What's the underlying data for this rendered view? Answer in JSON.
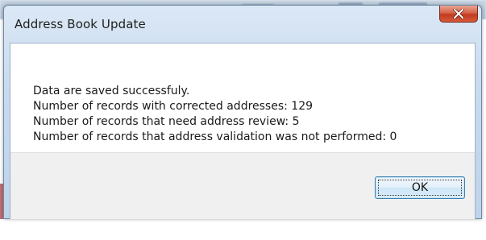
{
  "dialog": {
    "title": "Address Book Update",
    "close_icon": "close-x-icon",
    "messages": [
      "Data are saved successfuly.",
      "Number of records with corrected addresses: 129",
      "Number of records that need address review: 5",
      "Number of records that address validation was not performed: 0"
    ],
    "ok_label": "OK"
  },
  "colors": {
    "close_button": "#c23a20",
    "ok_border": "#3c7fb1",
    "titlebar": "#c8daee"
  }
}
